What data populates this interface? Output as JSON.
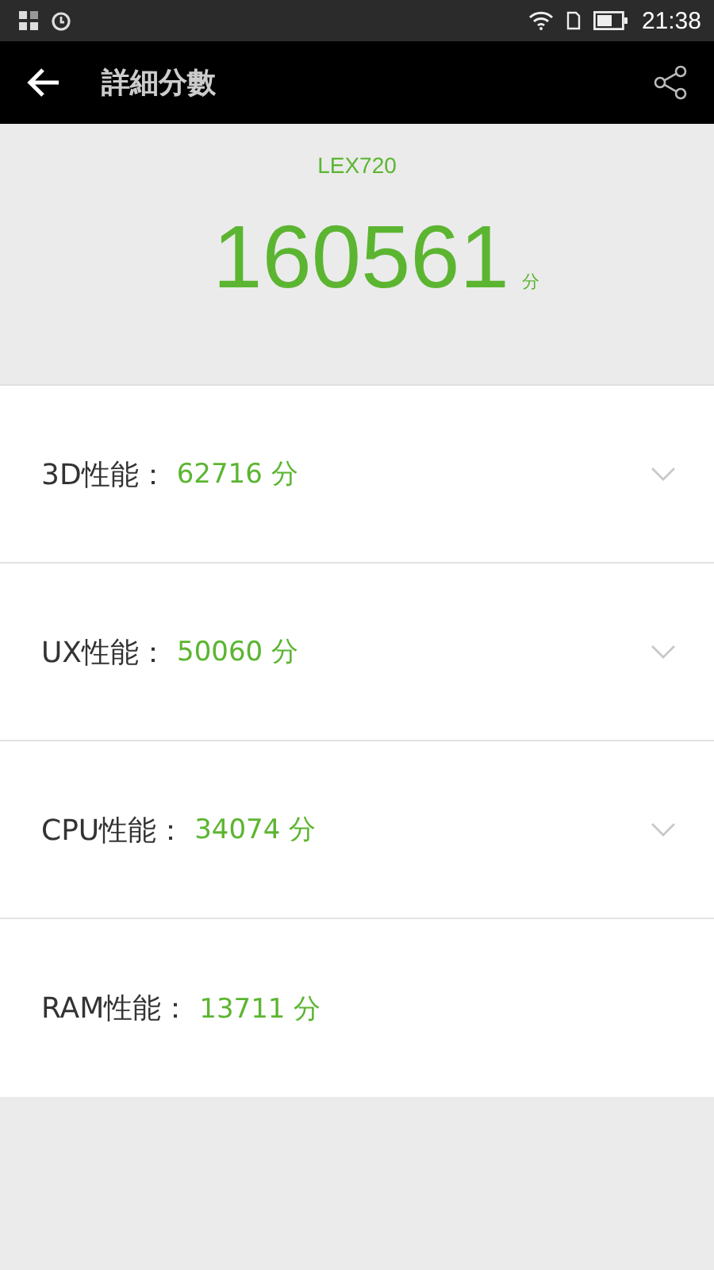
{
  "status_bar": {
    "time": "21:38"
  },
  "toolbar": {
    "title": "詳細分數"
  },
  "summary": {
    "device": "LEX720",
    "score": "160561",
    "unit": "分"
  },
  "scores": [
    {
      "label": "3D性能：",
      "value": "62716 分",
      "kind": "expandable",
      "expanded": false
    },
    {
      "label": "UX性能：",
      "value": "50060 分",
      "kind": "expandable",
      "expanded": false
    },
    {
      "label": "CPU性能：",
      "value": "34074 分",
      "kind": "expandable",
      "expanded": false
    },
    {
      "label": "RAM性能：",
      "value": "13711 分",
      "kind": "plain"
    }
  ]
}
